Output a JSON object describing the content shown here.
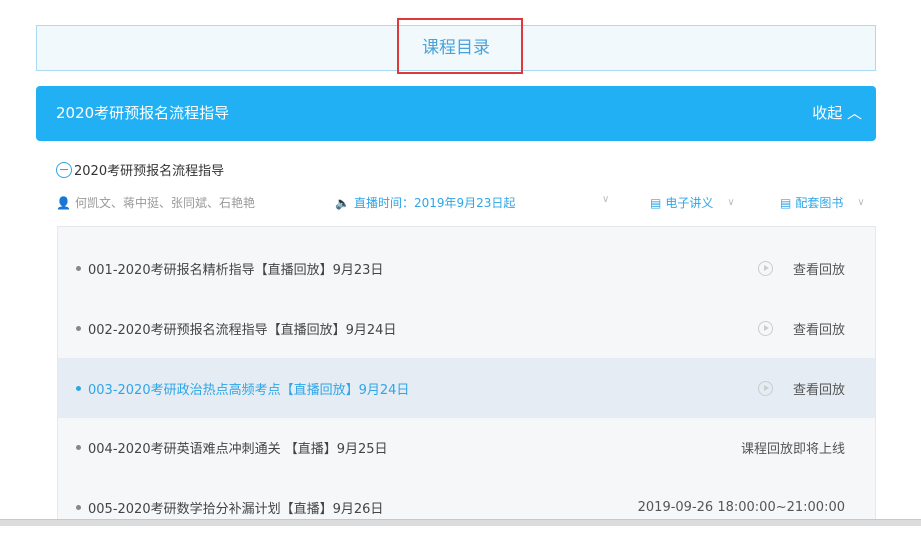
{
  "catalog_title": "课程目录",
  "header": {
    "title": "2020考研预报名流程指导",
    "collapse_label": "收起"
  },
  "section": {
    "title": "2020考研预报名流程指导",
    "teachers": "何凯文、蒋中挺、张同斌、石艳艳",
    "live_time": "直播时间：2019年9月23日起",
    "handout": "电子讲义",
    "books": "配套图书"
  },
  "lessons": [
    {
      "title": "001-2020考研报名精析指导【直播回放】9月23日",
      "action": "查看回放",
      "replay": true
    },
    {
      "title": "002-2020考研预报名流程指导【直播回放】9月24日",
      "action": "查看回放",
      "replay": true
    },
    {
      "title": "003-2020考研政治热点高频考点【直播回放】9月24日",
      "action": "查看回放",
      "replay": true
    },
    {
      "title": "004-2020考研英语难点冲刺通关 【直播】9月25日",
      "action": "课程回放即将上线",
      "replay": false
    },
    {
      "title": "005-2020考研数学拾分补漏计划【直播】9月26日",
      "action": "2019-09-26 18:00:00~21:00:00",
      "replay": false
    }
  ],
  "colors": {
    "accent": "#22b0f4",
    "highlight": "#e5ecf4",
    "link": "#2ea6e6"
  }
}
